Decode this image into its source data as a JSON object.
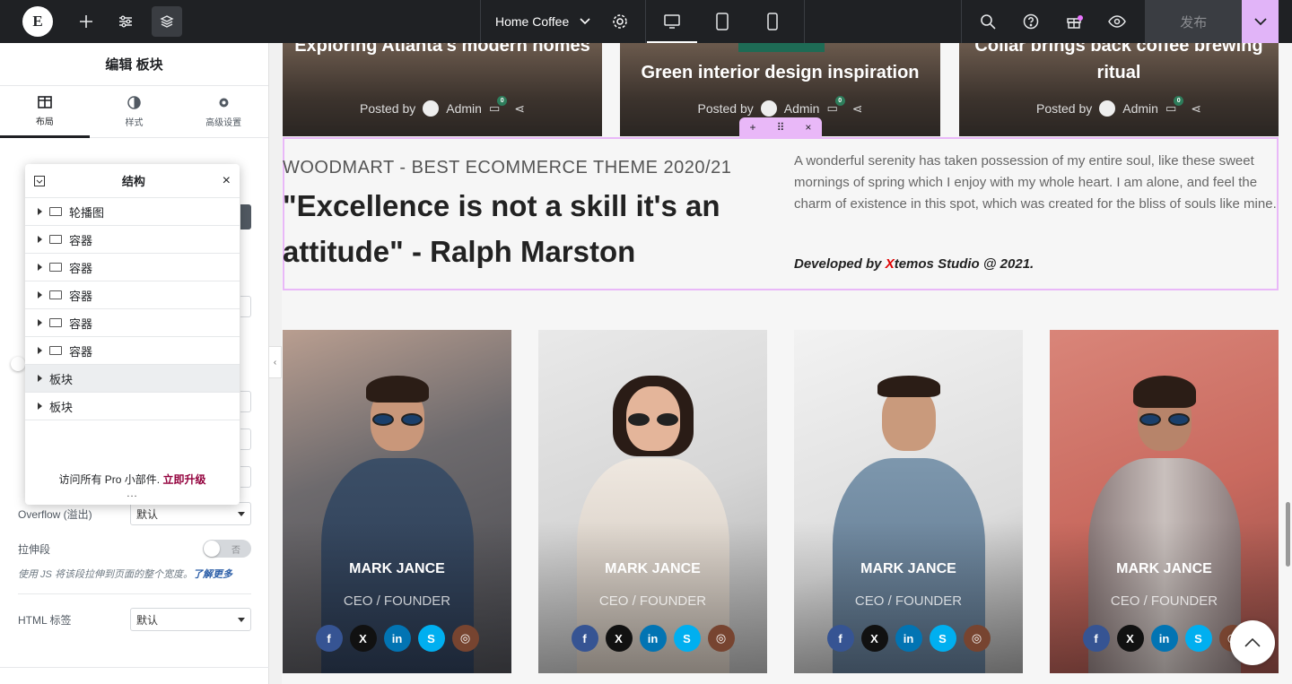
{
  "topbar": {
    "page_name": "Home Coffee",
    "publish_label": "发布",
    "icons": [
      "elementor-logo",
      "plus-icon",
      "sliders-icon",
      "layers-icon",
      "chevron-down-icon",
      "gear-icon",
      "desktop-icon",
      "tablet-icon",
      "mobile-icon",
      "search-icon",
      "help-icon",
      "gift-icon",
      "eye-icon"
    ]
  },
  "panel": {
    "title": "编辑 板块",
    "tabs": [
      {
        "label": "布局",
        "icon": "layout-icon"
      },
      {
        "label": "样式",
        "icon": "style-icon"
      },
      {
        "label": "高级设置",
        "icon": "gear-icon"
      }
    ],
    "overflow_label": "Overflow (溢出)",
    "overflow_value": "默认",
    "stretch_label": "拉伸段",
    "stretch_value": "否",
    "stretch_help": "使用 JS 将该段拉伸到页面的整个宽度。",
    "learn_more": "了解更多",
    "html_tag_label": "HTML 标签",
    "html_tag_value": "默认"
  },
  "structure": {
    "title": "结构",
    "items": [
      "轮播图",
      "容器",
      "容器",
      "容器",
      "容器",
      "容器",
      "板块",
      "板块"
    ],
    "pro_text": "访问所有 Pro 小部件.",
    "pro_link": "立即升级",
    "more": "..."
  },
  "canvas": {
    "blogs": [
      {
        "title": "Exploring Atlanta's modern homes",
        "posted_by": "Posted by",
        "author": "Admin",
        "comments": "0"
      },
      {
        "title": "Green interior design inspiration",
        "posted_by": "Posted by",
        "author": "Admin",
        "comments": "0"
      },
      {
        "title": "Collar brings back coffee brewing ritual",
        "posted_by": "Posted by",
        "author": "Admin",
        "comments": "0"
      }
    ],
    "overline": "WOODMART - BEST ECOMMERCE THEME 2020/21",
    "quote": "\"Excellence is not a skill it's an attitude\" - Ralph Marston",
    "paragraph": "A wonderful serenity has taken possession of my entire soul, like these sweet mornings of spring which I enjoy with my whole heart. I am alone, and feel the charm of existence in this spot, which was created for the bliss of souls like mine.",
    "dev_pre": "Developed by ",
    "dev_x": "X",
    "dev_post": "temos Studio @ 2021.",
    "team": [
      {
        "name": "MARK JANCE",
        "role": "CEO / FOUNDER"
      },
      {
        "name": "MARK JANCE",
        "role": "CEO / FOUNDER"
      },
      {
        "name": "MARK JANCE",
        "role": "CEO / FOUNDER"
      },
      {
        "name": "MARK JANCE",
        "role": "CEO / FOUNDER"
      }
    ],
    "social": {
      "fb": "f",
      "x": "X",
      "li": "in",
      "sk": "S",
      "ig": "◎"
    }
  },
  "colors": {
    "accent": "#e9b8f8",
    "dark": "#1f2124",
    "link": "#93003c"
  }
}
